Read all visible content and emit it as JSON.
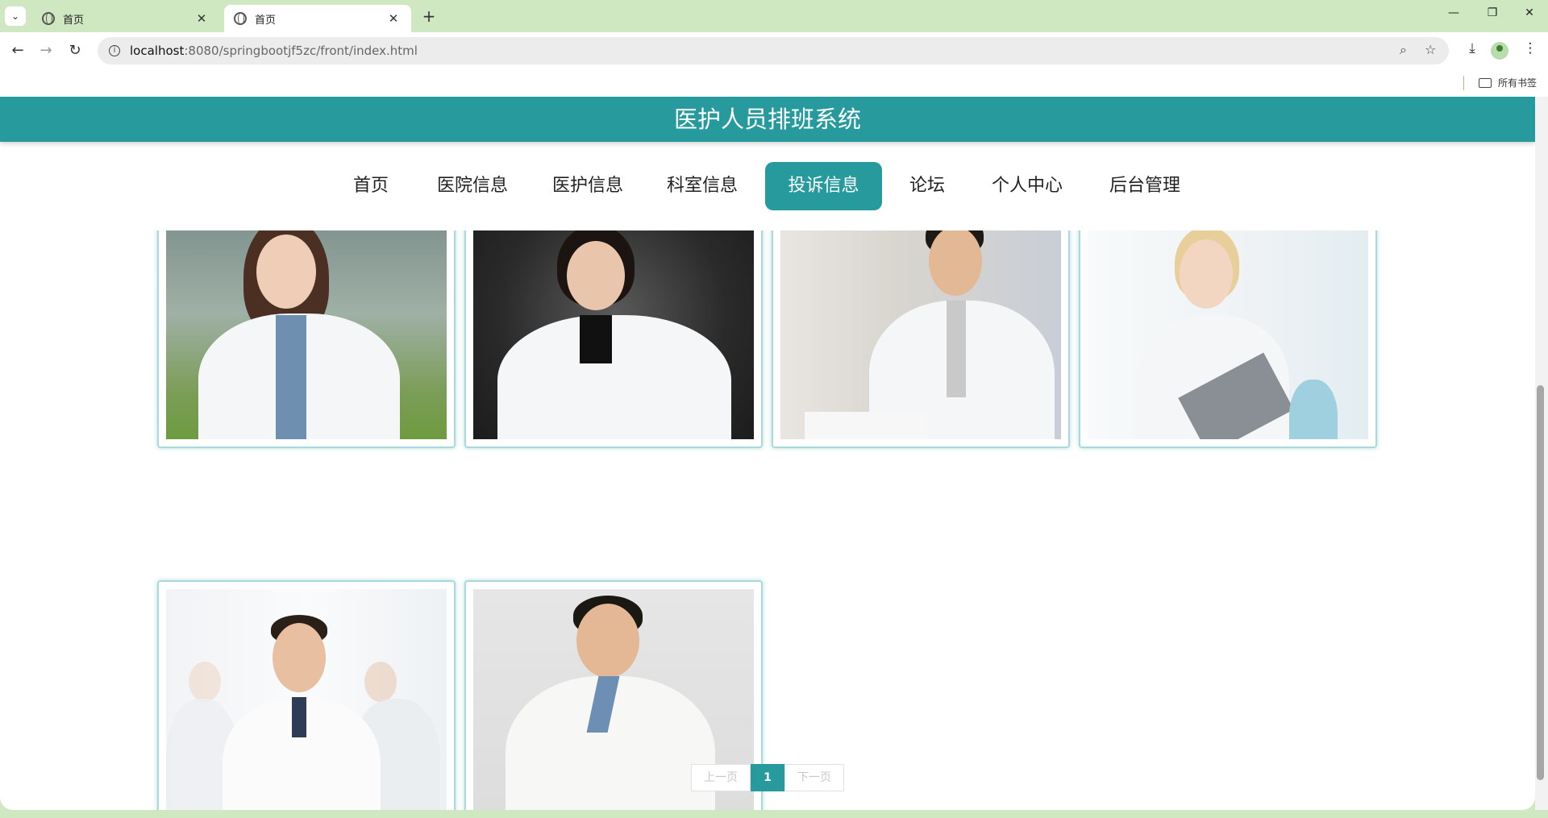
{
  "browser": {
    "tabs": [
      {
        "title": "首页"
      },
      {
        "title": "首页"
      }
    ],
    "url": {
      "host": "localhost",
      "path": ":8080/springbootjf5zc/front/index.html"
    },
    "bookmarks": {
      "folder_label": "所有书签"
    }
  },
  "site": {
    "title": "医护人员排班系统",
    "nav": [
      {
        "label": "首页",
        "active": false
      },
      {
        "label": "医院信息",
        "active": false
      },
      {
        "label": "医护信息",
        "active": false
      },
      {
        "label": "科室信息",
        "active": false
      },
      {
        "label": "投诉信息",
        "active": true
      },
      {
        "label": "论坛",
        "active": false
      },
      {
        "label": "个人中心",
        "active": false
      },
      {
        "label": "后台管理",
        "active": false
      }
    ],
    "pagination": {
      "prev": "上一页",
      "current": "1",
      "next": "下一页"
    }
  },
  "colors": {
    "brand": "#279a9e",
    "tab_bar": "#cfe8c2"
  },
  "icons": [
    "tab-list-icon",
    "globe-icon",
    "close-icon",
    "plus-icon",
    "minimize-icon",
    "restore-icon",
    "back-icon",
    "forward-icon",
    "reload-icon",
    "info-icon",
    "zoom-icon",
    "star-icon",
    "download-icon",
    "profile-icon",
    "more-icon",
    "folder-icon"
  ]
}
